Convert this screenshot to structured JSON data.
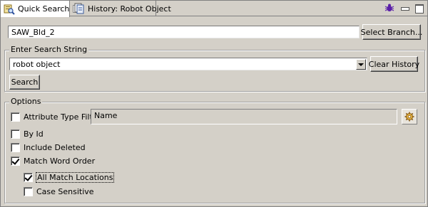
{
  "tabs": [
    {
      "label": "Quick Search",
      "active": true,
      "icon": "quick-search-icon"
    },
    {
      "label": "History: Robot Object",
      "active": false,
      "icon": "history-icon"
    }
  ],
  "view_toolbar": {
    "icons": [
      "bug-icon",
      "minimize-icon",
      "maximize-icon"
    ]
  },
  "branch": {
    "value": "SAW_Bld_2",
    "select_label": "Select Branch..."
  },
  "search_group": {
    "legend": "Enter Search String",
    "value": "robot object",
    "clear_label": "Clear History",
    "search_label": "Search"
  },
  "options": {
    "legend": "Options",
    "attribute_filter": {
      "label": "Attribute Type Filter:",
      "checked": false,
      "value": "Name"
    },
    "by_id": {
      "label": "By Id",
      "checked": false
    },
    "include_deleted": {
      "label": "Include Deleted",
      "checked": false
    },
    "match_word_order": {
      "label": "Match Word Order",
      "checked": true
    },
    "all_match_locations": {
      "label": "All Match Locations",
      "checked": true
    },
    "case_sensitive": {
      "label": "Case Sensitive",
      "checked": false
    }
  },
  "colors": {
    "background": "#d4d0c8",
    "active_tab": "#ffffff",
    "bug_icon": "#5a1fa8"
  }
}
